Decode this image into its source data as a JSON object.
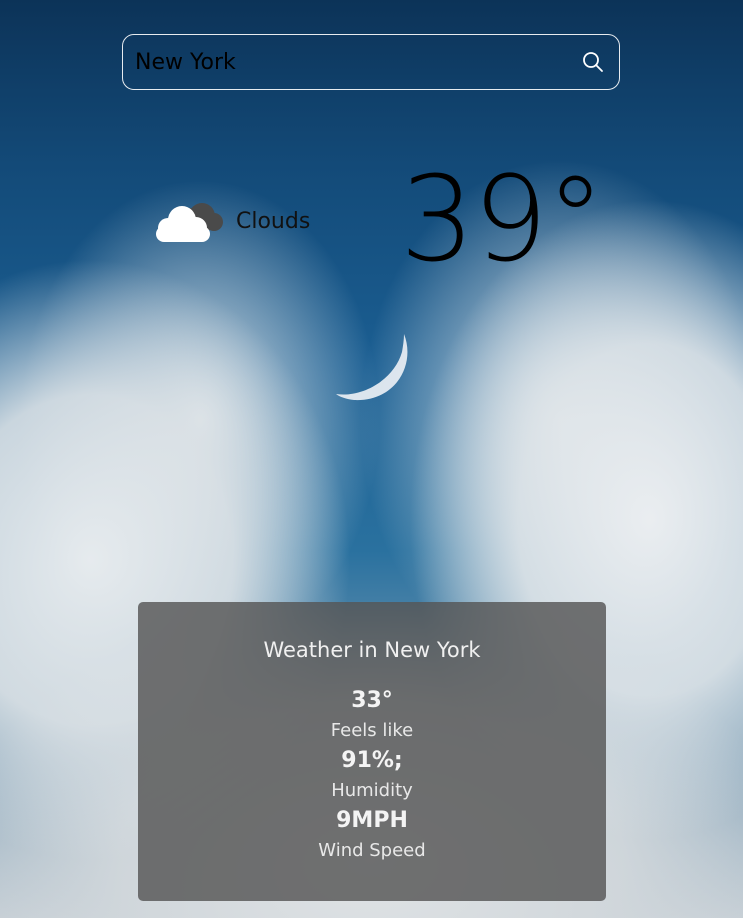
{
  "search": {
    "value": "New York",
    "icon": "search-icon"
  },
  "current": {
    "condition_icon": "cloud-icon",
    "condition": "Clouds",
    "temperature": "39°"
  },
  "details": {
    "heading": "Weather in New York",
    "feels_like_value": "33°",
    "feels_like_label": "Feels like",
    "humidity_value": "91%;",
    "humidity_label": "Humidity",
    "wind_value": "9MPH",
    "wind_label": "Wind Speed"
  }
}
